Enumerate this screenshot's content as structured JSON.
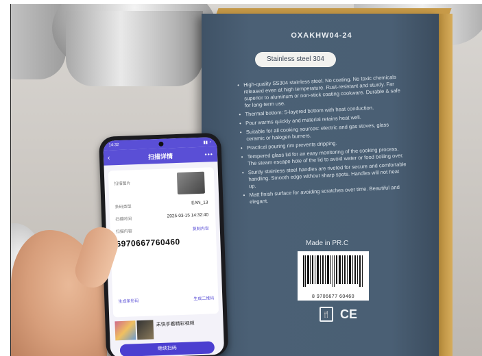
{
  "top_caption": "",
  "box": {
    "model": "OXAKHW04-24",
    "material_label": "Stainless steel 304",
    "features": [
      "High-quality SS304 stainless steel. No coating. No toxic chemicals released even at high temperature. Rust-resistant and sturdy. Far superior to aluminum or non-stick coating cookware. Durable & safe for long-term use.",
      "Thermal bottom: 5-layered bottom with heat conduction.",
      "Pour warms quickly and material retains heat well.",
      "Suitable for all cooking sources: electric and gas stoves, glass ceramic or halogen burners.",
      "Practical pouring rim prevents dripping.",
      "Tempered glass lid for an easy monitoring of the cooking process. The steam escape hole of the lid to avoid water or food boiling over.",
      "Sturdy stainless steel handles are riveted for secure and comfortable handling. Smooth edge without sharp spots. Handles will not heat up.",
      "Matt finish surface for avoiding scratches over time. Beautiful and elegant."
    ],
    "made_in": "Made in PR.C",
    "barcode_number": "8 9706677 60460",
    "ce_mark": "CE",
    "food_mark": "🍴"
  },
  "phone": {
    "status_time": "14:32",
    "app_title": "扫描详情",
    "rows": {
      "image_label": "扫描图片",
      "type_label": "条码类型",
      "type_value": "EAN_13",
      "time_label": "扫描时间",
      "time_value": "2025-03-15 14:32:40",
      "content_label": "扫描内容",
      "copy_label": "复制内容"
    },
    "code": "6970667760460",
    "link_left": "生成条形码",
    "link_right": "生成二维码",
    "ad_title": "未快手看精彩视频",
    "scan_button": "继续扫码"
  }
}
